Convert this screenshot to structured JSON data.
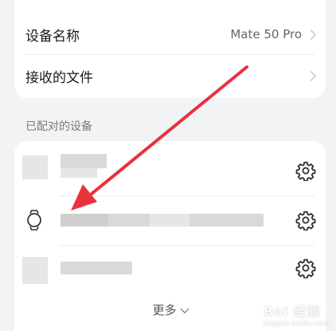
{
  "settings": {
    "device_name_label": "设备名称",
    "device_name_value": "Mate 50 Pro",
    "received_files_label": "接收的文件"
  },
  "paired": {
    "section_title": "已配对的设备",
    "more_label": "更多"
  },
  "annotation": {
    "arrow_color": "#e8323c"
  },
  "icons": [
    "chevron-right-icon",
    "watch-icon",
    "gear-icon",
    "chevron-down-icon"
  ],
  "watermark": {
    "brand": "Bai 经验",
    "sub": "jingyan.baidu.com"
  }
}
